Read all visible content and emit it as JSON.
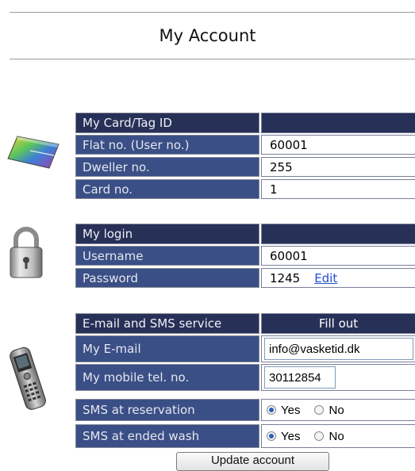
{
  "page": {
    "title": "My Account"
  },
  "card_section": {
    "header": "My Card/Tag ID",
    "header_value": "",
    "rows": [
      {
        "label": "Flat no. (User no.)",
        "value": "60001"
      },
      {
        "label": "Dweller no.",
        "value": "255"
      },
      {
        "label": "Card no.",
        "value": "1"
      }
    ]
  },
  "login_section": {
    "header": "My login",
    "header_value": "",
    "username_label": "Username",
    "username_value": "60001",
    "password_label": "Password",
    "password_value": "1245",
    "edit_link": "Edit"
  },
  "contact_section": {
    "header": "E-mail and SMS service",
    "header_value": "Fill out",
    "email_label": "My E-mail",
    "email_value": "info@vasketid.dk",
    "mobile_label": "My mobile tel. no.",
    "mobile_value": "30112854",
    "sms_reservation_label": "SMS at reservation",
    "sms_ended_label": "SMS at ended wash",
    "yes_label": "Yes",
    "no_label": "No",
    "sms_reservation_selected": "Yes",
    "sms_ended_selected": "Yes"
  },
  "update_button": "Update account",
  "icons": {
    "card": "card-icon",
    "lock": "padlock-icon",
    "phone": "mobile-phone-icon"
  },
  "colors": {
    "label_bg": "#3a4f86",
    "header_bg": "#273057",
    "link": "#1f4fd0"
  }
}
